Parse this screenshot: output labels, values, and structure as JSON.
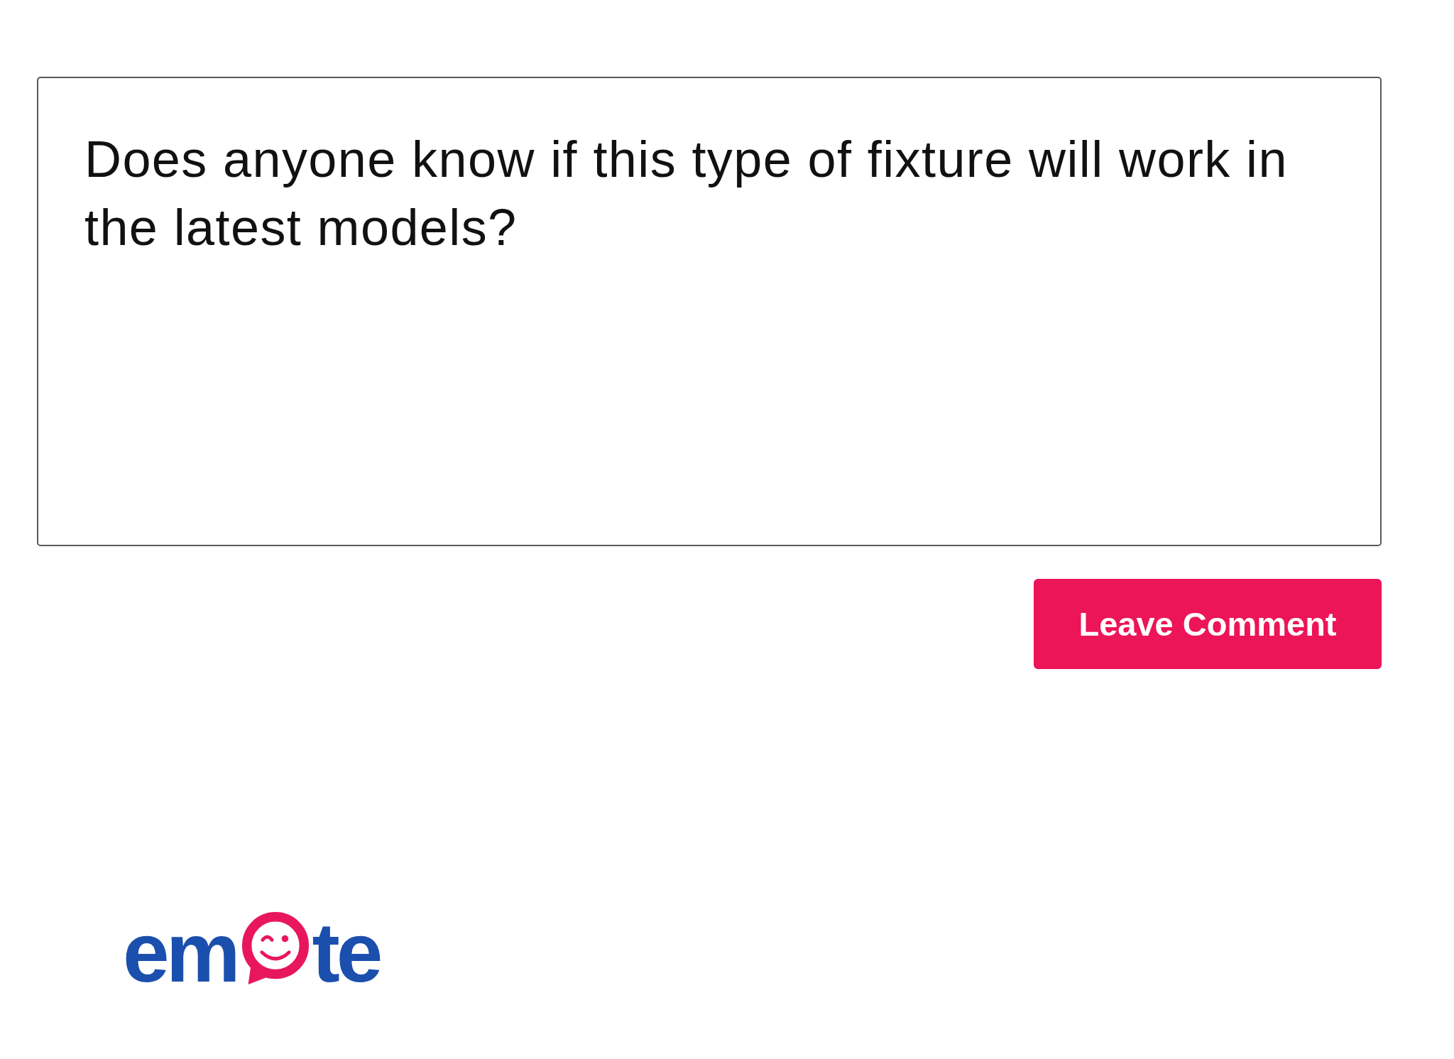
{
  "comment_box": {
    "value": "Does anyone know if this type of fixture will work in the latest models?"
  },
  "submit_button": {
    "label": "Leave Comment"
  },
  "logo": {
    "leading": "em",
    "trailing": "te"
  }
}
